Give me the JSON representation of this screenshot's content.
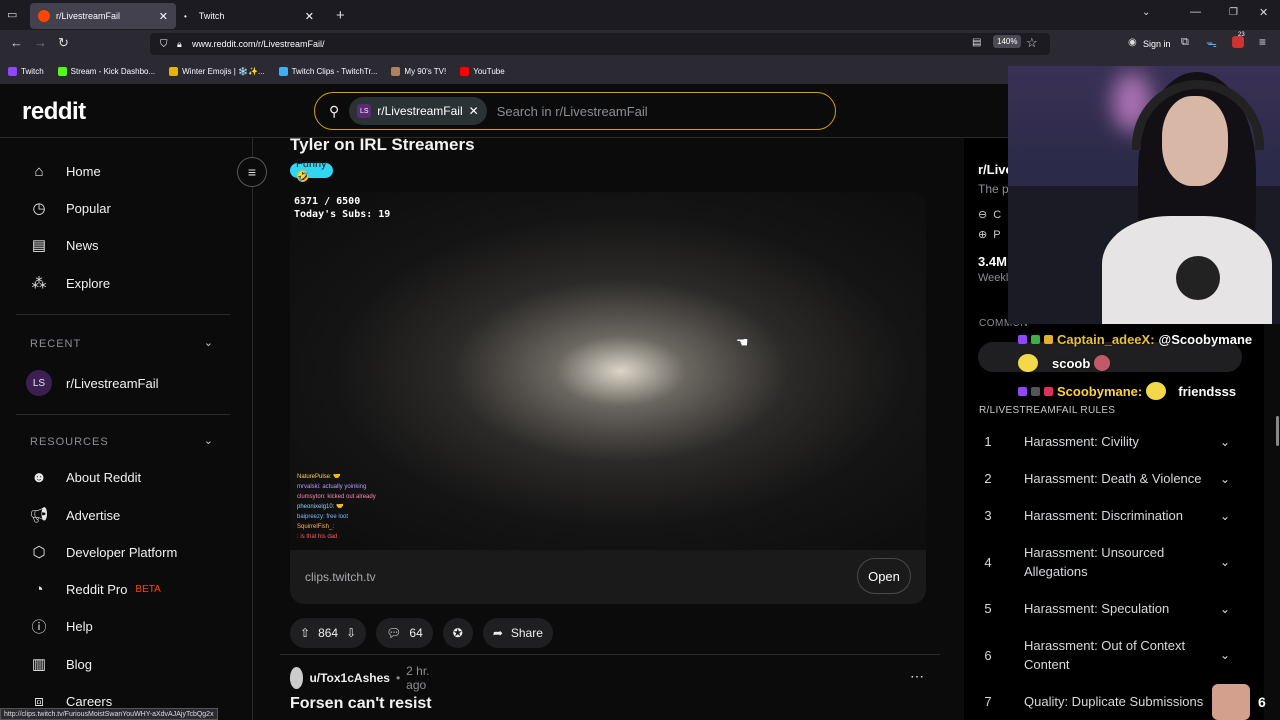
{
  "browser": {
    "tabs": [
      {
        "label": "r/LivestreamFail",
        "active": true
      },
      {
        "label": "Twitch",
        "active": false
      }
    ],
    "url": "www.reddit.com/r/LivestreamFail/",
    "zoom": "140%",
    "sign_in": "Sign in",
    "notif_count": "23",
    "bookmarks": [
      "Twitch",
      "Stream - Kick Dashbo...",
      "Winter Emojis | ❄️✨...",
      "Twitch Clips - TwitchTr...",
      "My 90's TV!",
      "YouTube"
    ],
    "status_url": "http://clips.twitch.tv/FuriousMoistSwanYouWHY-aXdvAJAjyTcbQg2x"
  },
  "header": {
    "logo": "reddit",
    "search_chip": "r/LivestreamFail",
    "search_placeholder": "Search in r/LivestreamFail"
  },
  "sidebar": {
    "nav": [
      {
        "label": "Home",
        "icon": "home-icon"
      },
      {
        "label": "Popular",
        "icon": "popular-icon"
      },
      {
        "label": "News",
        "icon": "news-icon"
      },
      {
        "label": "Explore",
        "icon": "explore-icon"
      }
    ],
    "recent_header": "RECENT",
    "recent_item": "r/LivestreamFail",
    "resources_header": "RESOURCES",
    "resources": [
      {
        "label": "About Reddit",
        "icon": "reddit-alien-icon"
      },
      {
        "label": "Advertise",
        "icon": "megaphone-icon"
      },
      {
        "label": "Developer Platform",
        "icon": "developer-icon"
      },
      {
        "label": "Reddit Pro",
        "icon": "pro-icon"
      },
      {
        "label": "Help",
        "icon": "help-icon"
      },
      {
        "label": "Blog",
        "icon": "blog-icon"
      },
      {
        "label": "Careers",
        "icon": "careers-icon"
      }
    ],
    "beta": "BETA"
  },
  "post": {
    "title": "Tyler on IRL Streamers",
    "flair": "Funny 🤣",
    "video_overlay_1": "6371 / 6500",
    "video_overlay_2": "Today's Subs: 19",
    "chat_lines": [
      "NaturePulse: 🤝",
      "mrvalski: actually yoinking",
      "clumsyton: kicked out already",
      "pheonixelg10: 🤝",
      "baipreezy: free loot",
      "SquirrelFish_:",
      ": is that his dad"
    ],
    "link": "clips.twitch.tv",
    "open": "Open",
    "votes": "864",
    "comments": "64",
    "share": "Share"
  },
  "next_post": {
    "author": "u/Tox1cAshes",
    "time": "2 hr. ago",
    "title": "Forsen can't resist"
  },
  "right": {
    "name": "r/Live",
    "desc": "The p",
    "members": "3.4M",
    "weekly": "Weekl",
    "row1": "C",
    "row2": "P",
    "communities": "COMMUN",
    "rules_header": "R/LIVESTREAMFAIL RULES",
    "rules": [
      {
        "n": "1",
        "text": "Harassment: Civility"
      },
      {
        "n": "2",
        "text": "Harassment: Death & Violence"
      },
      {
        "n": "3",
        "text": "Harassment: Discrimination"
      },
      {
        "n": "4",
        "text": "Harassment: Unsourced Allegations"
      },
      {
        "n": "5",
        "text": "Harassment: Speculation"
      },
      {
        "n": "6",
        "text": "Harassment: Out of Context Content"
      },
      {
        "n": "7",
        "text": "Quality: Duplicate Submissions"
      }
    ]
  },
  "overlay": {
    "chat": [
      {
        "user": "Captain_adeeX:",
        "msg": "@Scoobymane"
      },
      {
        "user": "",
        "msg": "scoob"
      },
      {
        "user": "Scoobymane:",
        "msg": "friendsss"
      }
    ],
    "viewer_count": "6"
  },
  "colors": {
    "accent": "#ff4500",
    "search_border": "#d7a100",
    "flair": "#33d6f2"
  }
}
